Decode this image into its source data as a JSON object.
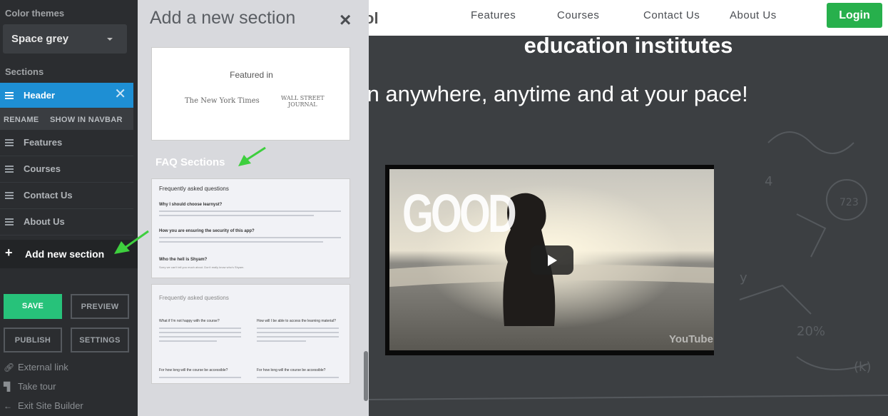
{
  "sidebar": {
    "color_themes_label": "Color themes",
    "theme_value": "Space grey",
    "sections_label": "Sections",
    "header_item": "Header",
    "rename": "RENAME",
    "show_in_navbar": "SHOW IN NAVBAR",
    "items": [
      "Features",
      "Courses",
      "Contact Us",
      "About Us"
    ],
    "add_new_section": "Add new section",
    "save": "SAVE",
    "preview": "PREVIEW",
    "publish": "PUBLISH",
    "settings": "SETTINGS",
    "external_link": "External link",
    "take_tour": "Take tour",
    "exit": "Exit Site Builder"
  },
  "panel": {
    "title": "Add a new section",
    "close": "×",
    "featured_in": "Featured in",
    "nyt": "The New York Times",
    "wsj_line1": "WALL STREET",
    "wsj_line2": "JOURNAL",
    "faq_heading": "FAQ Sections",
    "faq1": {
      "title": "Frequently asked questions",
      "q1": "Why I should choose learnyst?",
      "q2": "How you are ensuring the security of this app?",
      "q3": "Who the hell is Shyam?",
      "a3": "Sorry we can't tell you much about. Don't really know who's Shyam."
    },
    "faq2": {
      "title": "Frequently asked questions",
      "q1": "What if I'm not happy with the course?",
      "q2": "How will I be able to access the learning material?",
      "q3": "For how long will the course be accessible?",
      "q4": "For how long will the course be accessible?"
    }
  },
  "site": {
    "brand_fragment": "ol",
    "nav": [
      "Features",
      "Courses",
      "Contact Us",
      "About Us"
    ],
    "login": "Login",
    "hero_title": "education institutes",
    "hero_sub": "arn anywhere, anytime and at your pace!",
    "video_word": "GOOD",
    "video_logo": "YouTube"
  },
  "colors": {
    "accent_blue": "#1e8fd4",
    "save_green": "#27c27a",
    "login_green": "#27b04c",
    "annotation_arrow": "#3ecf3e"
  }
}
